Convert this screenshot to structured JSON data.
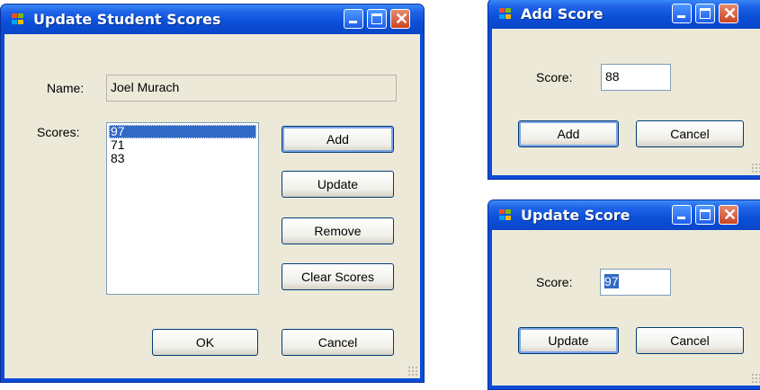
{
  "update_student": {
    "title": "Update Student Scores",
    "name_label": "Name:",
    "name_value": "Joel Murach",
    "scores_label": "Scores:",
    "scores": [
      "97",
      "71",
      "83"
    ],
    "selected_index": 0,
    "buttons": {
      "add": "Add",
      "update": "Update",
      "remove": "Remove",
      "clear": "Clear Scores",
      "ok": "OK",
      "cancel": "Cancel"
    }
  },
  "add_score": {
    "title": "Add Score",
    "score_label": "Score:",
    "score_value": "88",
    "buttons": {
      "add": "Add",
      "cancel": "Cancel"
    }
  },
  "update_score": {
    "title": "Update Score",
    "score_label": "Score:",
    "score_value": "97",
    "buttons": {
      "update": "Update",
      "cancel": "Cancel"
    }
  },
  "colors": {
    "titlebar": "#0b50d8",
    "client": "#ece9d8",
    "selection": "#316ac5",
    "close_button": "#cc4422"
  },
  "icons": {
    "app": "windows-form-icon",
    "minimize": "minimize-icon",
    "maximize": "maximize-icon",
    "close": "close-icon"
  }
}
